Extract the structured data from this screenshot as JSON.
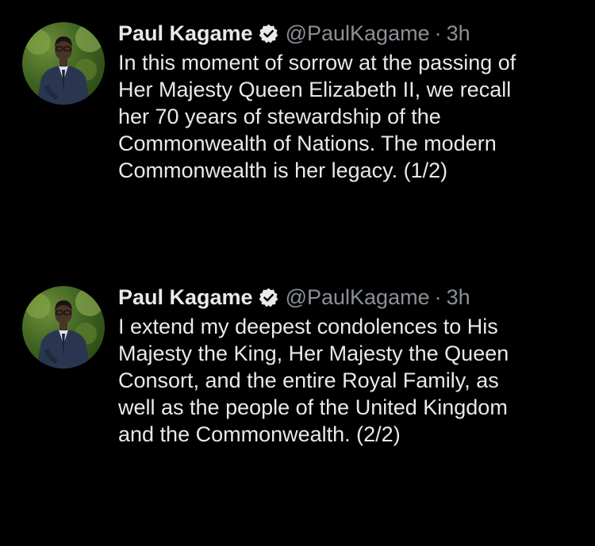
{
  "tweets": [
    {
      "author": {
        "name": "Paul Kagame",
        "handle": "@PaulKagame",
        "separator": "·",
        "time": "3h"
      },
      "lines": [
        "In this moment of sorrow at the passing of",
        "Her Majesty Queen Elizabeth II, we recall",
        "her 70 years of stewardship of the",
        "Commonwealth of Nations. The modern",
        "Commonwealth is her legacy. (1/2)"
      ]
    },
    {
      "author": {
        "name": "Paul Kagame",
        "handle": "@PaulKagame",
        "separator": "·",
        "time": "3h"
      },
      "lines": [
        "I extend my deepest condolences to His",
        "Majesty the King, Her Majesty the Queen",
        "Consort, and the entire Royal Family, as",
        "well as the people of the United Kingdom",
        "and the Commonwealth. (2/2)"
      ]
    }
  ],
  "colors": {
    "background": "#000000",
    "text": "#e7e9ea",
    "secondary_text": "#8b9096"
  },
  "icons": {
    "verified": "verified-badge-icon",
    "avatar": "profile-photo"
  }
}
